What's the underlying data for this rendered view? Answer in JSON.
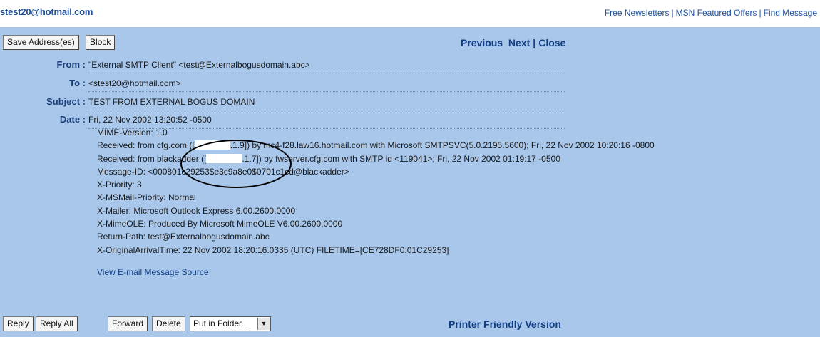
{
  "account": {
    "email": "stest20@hotmail.com"
  },
  "top_links": [
    "Free Newsletters",
    "MSN Featured Offers",
    "Find Message"
  ],
  "toolbar_top": {
    "save": "Save Address(es)",
    "block": "Block"
  },
  "nav": {
    "previous": "Previous",
    "next": "Next",
    "close": "Close"
  },
  "headers": {
    "from_label": "From :",
    "from_value": "\"External SMTP Client\" <test@Externalbogusdomain.abc>",
    "to_label": "To :",
    "to_value": "<stest20@hotmail.com>",
    "subject_label": "Subject :",
    "subject_value": "TEST FROM EXTERNAL BOGUS DOMAIN",
    "date_label": "Date :",
    "date_value": "Fri, 22 Nov 2002 13:20:52 -0500"
  },
  "raw": {
    "mime": "MIME-Version: 1.0",
    "recv1_a": "Received: from cfg.com ([",
    "recv1_b": ".1.9]) by mc4-f28.law16.hotmail.com with Microsoft SMTPSVC(5.0.2195.5600); Fri, 22 Nov 2002 10:20:16 -0800",
    "recv2_a": "Received: from blackadder ([",
    "recv2_b": ".1.7]) by fwserver.cfg.com with SMTP id <119041>; Fri, 22 Nov 2002 01:19:17 -0500",
    "msgid": "Message-ID: <000801c29253$e3c9a8e0$0701c1cd@blackadder>",
    "priority": "X-Priority: 3",
    "mspriority": "X-MSMail-Priority: Normal",
    "mailer": "X-Mailer: Microsoft Outlook Express 6.00.2600.0000",
    "mimeole": "X-MimeOLE: Produced By Microsoft MimeOLE V6.00.2600.0000",
    "return_path": "Return-Path: test@Externalbogusdomain.abc",
    "arrival": "X-OriginalArrivalTime: 22 Nov 2002 18:20:16.0335 (UTC) FILETIME=[CE728DF0:01C29253]"
  },
  "view_source": "View E-mail Message Source",
  "toolbar_bottom": {
    "reply": "Reply",
    "reply_all": "Reply All",
    "forward": "Forward",
    "delete": "Delete",
    "folder_select": "Put in Folder..."
  },
  "printer_friendly": "Printer Friendly Version",
  "colors": {
    "panel": "#a8c7ea",
    "link": "#123e86",
    "label": "#1b3f7a"
  }
}
